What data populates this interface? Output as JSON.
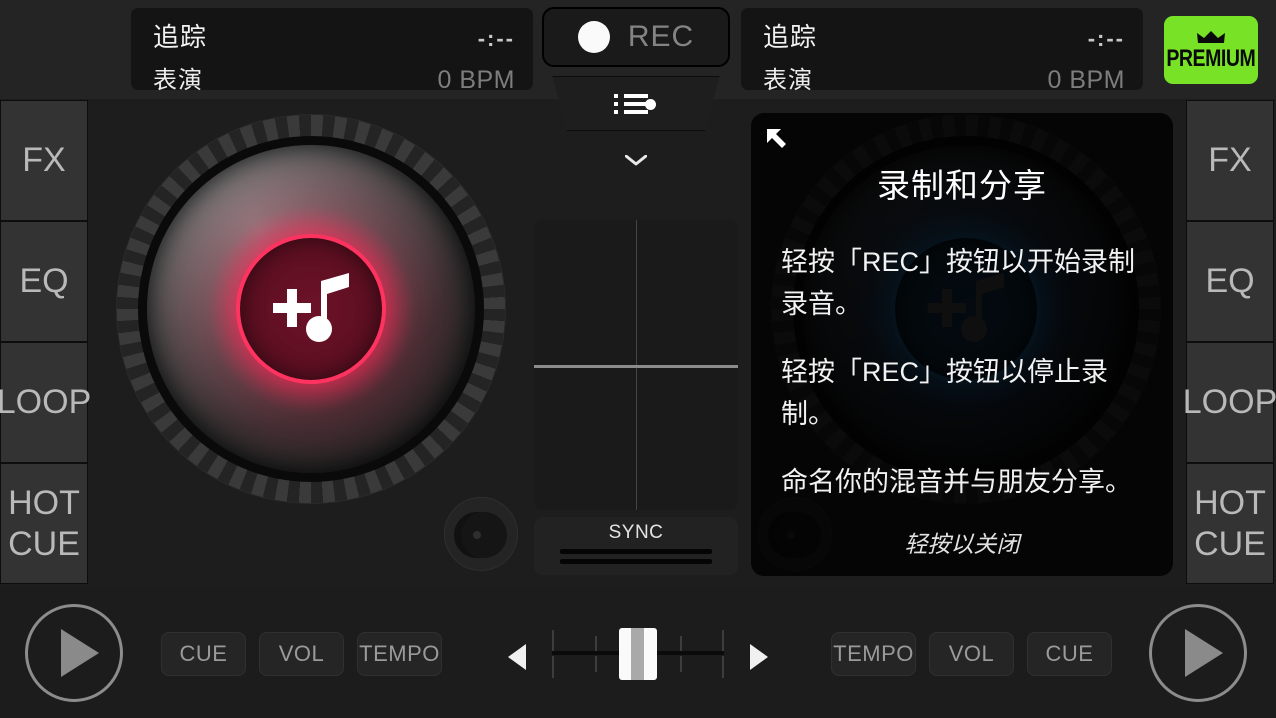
{
  "app": {
    "background_color": "#1d1d1d",
    "accent_red": "#ff3360",
    "accent_green": "#78e326"
  },
  "topbar": {
    "left_track": {
      "title": "追踪",
      "time": "-:--",
      "subtitle": "表演",
      "bpm": "0 BPM"
    },
    "right_track": {
      "title": "追踪",
      "time": "-:--",
      "subtitle": "表演",
      "bpm": "0 BPM"
    },
    "rec_button": {
      "label": "REC",
      "icon": "record-dot-icon"
    },
    "queue_button": {
      "icon": "queue-list-icon"
    },
    "collapse_button": {
      "icon": "chevron-down-icon"
    },
    "premium_button": {
      "label": "PREMIUM",
      "icon": "crown-icon"
    }
  },
  "left_deck": {
    "side_buttons": [
      {
        "label": "FX",
        "name": "fx"
      },
      {
        "label": "EQ",
        "name": "eq"
      },
      {
        "label": "LOOP",
        "name": "loop"
      },
      {
        "label": "HOT CUE",
        "name": "hot-cue"
      }
    ],
    "jog_icon": "add-music-icon"
  },
  "right_deck": {
    "side_buttons": [
      {
        "label": "FX",
        "name": "fx"
      },
      {
        "label": "EQ",
        "name": "eq"
      },
      {
        "label": "LOOP",
        "name": "loop"
      },
      {
        "label": "HOT CUE",
        "name": "hot-cue"
      }
    ],
    "jog_icon": "add-music-icon"
  },
  "center": {
    "sync_label": "SYNC"
  },
  "bottom": {
    "left_controls": [
      {
        "label": "CUE",
        "name": "cue"
      },
      {
        "label": "VOL",
        "name": "vol"
      },
      {
        "label": "TEMPO",
        "name": "tempo"
      }
    ],
    "right_controls": [
      {
        "label": "TEMPO",
        "name": "tempo"
      },
      {
        "label": "VOL",
        "name": "vol"
      },
      {
        "label": "CUE",
        "name": "cue"
      }
    ],
    "crossfader": {
      "position_percent": 50
    }
  },
  "overlay": {
    "arrow_icon": "arrow-up-left-icon",
    "title": "录制和分享",
    "paragraph_1": "轻按「REC」按钮以开始录制录音。",
    "paragraph_2": "轻按「REC」按钮以停止录制。",
    "paragraph_3": "命名你的混音并与朋友分享。",
    "close_hint": "轻按以关闭"
  }
}
